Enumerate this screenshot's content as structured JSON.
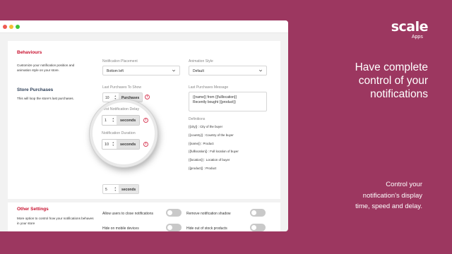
{
  "brand": {
    "name": "scale",
    "sub": "Apps"
  },
  "headline": {
    "lines": [
      "Have complete",
      "control of your",
      "notifications"
    ]
  },
  "subline": {
    "lines": [
      "Control your",
      "notification's display",
      "time, speed and delay."
    ]
  },
  "colors": {
    "background": "#9c3760",
    "accent": "#c8102e",
    "info": "#d9415b"
  },
  "behaviours": {
    "title": "Behaviours",
    "desc": "Customize your notification position and animation style on your store.",
    "placement_label": "Notification Placement",
    "placement_value": "Bottom left",
    "animation_label": "Animation Style",
    "animation_value": "Default"
  },
  "store_purchases": {
    "title": "Store Purchases",
    "desc": "This will loop the store's last purchases.",
    "last_label": "Last Purchases To Show",
    "last_value": "10",
    "last_unit": "Purchases",
    "message_label": "Last Purchases Message",
    "message_lines": [
      "{{name}} from {{fulllocation}}",
      "Recently bought {{product}}"
    ],
    "defs_title": "Definitions",
    "defs": [
      "{{city}} : City of the buyer",
      "{{country}} : Country of the buyer",
      "{{name}} : Product",
      "{{fulllocation}} : Full location of buyer",
      "{{location}} : Location of buyer",
      "{{product}} : Product"
    ],
    "delay_label": "First Notification Delay",
    "delay_value": "1",
    "delay_unit": "seconds",
    "duration_label": "Notification Duration",
    "duration_value": "10",
    "duration_unit": "seconds",
    "third_value": "5",
    "third_unit": "seconds"
  },
  "other": {
    "title": "Other Settings",
    "desc": "More option to control how your notifications behaves in your store",
    "toggles": [
      {
        "label": "Allow users to close notifications",
        "on": false
      },
      {
        "label": "Remove notification shadow",
        "on": false
      },
      {
        "label": "Hide on mobile devices",
        "on": false
      },
      {
        "label": "Hide out of stock products",
        "on": false
      }
    ]
  },
  "icons": {
    "info": "info-icon",
    "chevron": "chevron-down-icon",
    "spinner": "spinner-arrows-icon"
  }
}
